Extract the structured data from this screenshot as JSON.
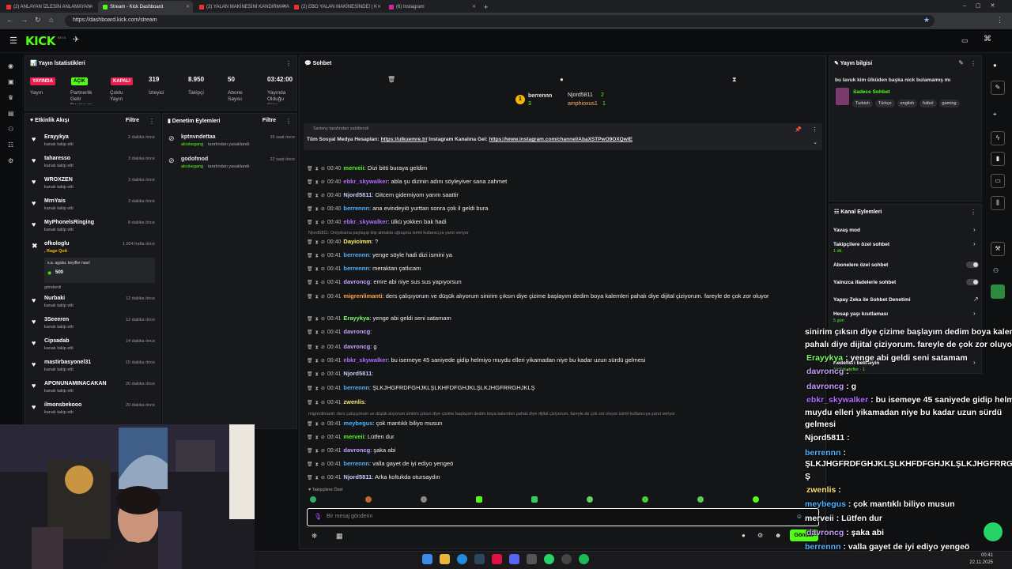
{
  "browser": {
    "tabs": [
      {
        "label": "(2) ANLAYAN İZLESİN ANLAMAYAN",
        "color": "#e33"
      },
      {
        "label": "Stream - Kick Dashboard",
        "color": "#53fc18"
      },
      {
        "label": "(2) YALAN MAKİNESİNİ KANDIRMAYA",
        "color": "#e33"
      },
      {
        "label": "(2) EBO YALAN MAKİNESİNDE! | K",
        "color": "#e33"
      },
      {
        "label": "(6) Instagram",
        "color": "#d6249f"
      }
    ],
    "url": "https://dashboard.kick.com/stream"
  },
  "header": {
    "logo": "KICK",
    "beta": "BETA"
  },
  "stats": {
    "title": "Yayın İstatistikleri",
    "badges": [
      "YAYINDA",
      "AÇIK",
      "KAPALI"
    ],
    "badge_colors": [
      "#e91e4d",
      "#53fc18",
      "#e91e4d"
    ],
    "badge_labels": [
      "Yayın",
      "Partnerlik Gelir Paylaşımı",
      "Çoklu Yayın"
    ],
    "values": [
      "319",
      "8.950",
      "50",
      "03:42:00"
    ],
    "labels": [
      "İzleyici",
      "Takipçi",
      "Abone Sayısı",
      "Yayında Olduğu Süre"
    ]
  },
  "events": {
    "title": "Etkinlik Akışı",
    "filter": "Filtre",
    "items": [
      {
        "name": "Erayykya",
        "sub": "kanalı takip etti",
        "time": "2 dakika önce"
      },
      {
        "name": "taharesso",
        "sub": "kanalı takip etti",
        "time": "3 dakika önce"
      },
      {
        "name": "WROXZEN",
        "sub": "kanalı takip etti",
        "time": "3 dakika önce"
      },
      {
        "name": "MrnYais",
        "sub": "kanalı takip etti",
        "time": "3 dakika önce"
      },
      {
        "name": "MyPhonelsRinging",
        "sub": "kanalı takip etti",
        "time": "8 dakika önce"
      },
      {
        "name": "ofkologlu",
        "sub": ", Rage Quit",
        "time": "1.924 hafta önce",
        "note": "s.a. agalar, keyifler nasıl",
        "amount": "500",
        "extra": "gönderdi"
      },
      {
        "name": "Nurbaki",
        "sub": "kanalı takip etti",
        "time": "12 dakika önce"
      },
      {
        "name": "3Seeeren",
        "sub": "kanalı takip etti",
        "time": "12 dakika önce"
      },
      {
        "name": "Cipsadab",
        "sub": "kanalı takip etti",
        "time": "14 dakika önce"
      },
      {
        "name": "mastirbasyonel31",
        "sub": "kanalı takip etti",
        "time": "15 dakika önce"
      },
      {
        "name": "APONUNAMINACAKAN",
        "sub": "kanalı takip etti",
        "time": "20 dakika önce"
      },
      {
        "name": "ilmonsbekooo",
        "sub": "kanalı takip etti",
        "time": "20 dakika önce"
      }
    ]
  },
  "moderation": {
    "title": "Denetim Eylemleri",
    "filter": "Filtre",
    "items": [
      {
        "name": "kptnvndettaa",
        "by": "aloskegang",
        "action": "tarafından yasaklandı",
        "time": "16 saat önce"
      },
      {
        "name": "godofmod",
        "by": "aloskegang",
        "action": "tarafından yasaklandı",
        "time": "22 saat önce"
      }
    ]
  },
  "chat": {
    "title": "Sohbet",
    "pinned_by": "Sarteny tarafından sabitlendi",
    "pinned_text": "Tüm Sosyal Medya Hesapları:",
    "pinned_link1": "https://ulkuemre.tr/",
    "pinned_mid": "Instagram Kanalına Gel:",
    "pinned_link2": "https://www.instagram.com/channel/AbaXSTPwO9OXQwIE",
    "top_gifters": [
      {
        "name": "berrennn",
        "count": "3"
      },
      {
        "name": "Njord5811",
        "count": "2"
      },
      {
        "name": "amphioxus1",
        "count": "1"
      }
    ],
    "messages": [
      {
        "time": "00:40",
        "user": "merveii",
        "color": "#53fc18",
        "text": "Dizi bitti buraya geldim"
      },
      {
        "time": "00:40",
        "user": "ebkr_skywalker",
        "color": "#b06cff",
        "text": "abla şu dizinin adını söyleyiver sana zahmet"
      },
      {
        "time": "00:40",
        "user": "Njord5811",
        "color": "#c8c8ff",
        "text": "Gitcem gidemiyom yarım saattir"
      },
      {
        "time": "00:40",
        "user": "berrennn",
        "color": "#4fb3ff",
        "text": "ana evindeyiö yurttan sonra çok il geldi bura"
      },
      {
        "time": "00:40",
        "user": "ebkr_skywalker",
        "color": "#b06cff",
        "text": "ülkü yokken bak hadi"
      },
      {
        "reply": "Njord5811: Onlydrama paylaşıp klip almakla uğraşma isimli kullanıcıya yanıt veriyor"
      },
      {
        "time": "00:40",
        "user": "Dayicimm",
        "color": "#fff36b",
        "text": "?"
      },
      {
        "time": "00:41",
        "user": "berrennn",
        "color": "#4fb3ff",
        "text": "yenge söyle hadi dizi ismini ya"
      },
      {
        "time": "00:41",
        "user": "berrennn",
        "color": "#4fb3ff",
        "text": "meraktan çatlıcam"
      },
      {
        "time": "00:41",
        "user": "davroncg",
        "color": "#c9a0ff",
        "text": "emre abi niye sus sus yapıyorsun"
      },
      {
        "time": "00:41",
        "user": "migrenlimanti",
        "color": "#ffa43a",
        "text": "ders çalışıyorum ve düşük alıyorum sinirim çıksın diye çizime başlayım dedim boya kalemleri pahalı diye dijital çiziyorum. fareyle de çok zor",
        "wrap": "oluyor"
      },
      {
        "time": "00:41",
        "user": "Erayykya",
        "color": "#7cff6a",
        "text": "yenge abi geldi seni satamam"
      },
      {
        "time": "00:41",
        "user": "davroncg",
        "color": "#c9a0ff",
        "text": ""
      },
      {
        "time": "00:41",
        "user": "davroncg",
        "color": "#c9a0ff",
        "text": "g"
      },
      {
        "time": "00:41",
        "user": "ebkr_skywalker",
        "color": "#b06cff",
        "text": "bu isemeye 45 saniyede gidip helmiyo muydu elleri yikamadan niye bu kadar uzun sürdü gelmesi"
      },
      {
        "time": "00:41",
        "user": "Njord5811",
        "color": "#c8c8ff",
        "text": ""
      },
      {
        "time": "00:41",
        "user": "berrennn",
        "color": "#4fb3ff",
        "text": "ŞLKJHGFRDFGHJKLŞLKHFDFGHJKLŞLKJHGFRRGHJKLŞ"
      },
      {
        "time": "00:41",
        "user": "zwenlis",
        "color": "#ffe56b",
        "text": ""
      },
      {
        "reply": "migrenlimanti: ders çalışıyorum ve düşük alıyorum sinirim çıksın diye çizime başlayım dedim boya kalemleri pahalı diye dijital çiziyorum. fareyle de çok zor oluyor isimli kullanıcıya yanıt veriyor"
      },
      {
        "time": "00:41",
        "user": "meybegus",
        "color": "#4fb3ff",
        "text": "çok mantıklı biliyo musun"
      },
      {
        "time": "00:41",
        "user": "merveii",
        "color": "#53fc18",
        "text": "Lütfen dur"
      },
      {
        "time": "00:41",
        "user": "davroncg",
        "color": "#c9a0ff",
        "text": "şaka abi"
      },
      {
        "time": "00:41",
        "user": "berrennn",
        "color": "#4fb3ff",
        "text": "valla gayet de iyi ediyo yengeö"
      },
      {
        "time": "00:41",
        "user": "Njord5811",
        "color": "#c8c8ff",
        "text": "Arka koltukda otursaydın"
      }
    ],
    "followers_only": "Takipçilere Özel",
    "input_placeholder": "Bir mesaj gönderin",
    "send": "Gönder"
  },
  "info": {
    "title": "Yayın bilgisi",
    "stream_title": "bu lavuk kim ülküden başka nick bulamamış mı",
    "category": "Sadece Sohbet",
    "tags": [
      "Turkish",
      "Türkçe",
      "english",
      "futbol",
      "gaming"
    ]
  },
  "channel_actions": {
    "title": "Kanal Eylemleri",
    "items": [
      {
        "label": "Yavaş mod",
        "sub": "",
        "kind": "chevron"
      },
      {
        "label": "Takipçilere özel sohbet",
        "sub": "1 dk.",
        "kind": "chevron"
      },
      {
        "label": "Abonelere özel sohbet",
        "sub": "",
        "kind": "toggle"
      },
      {
        "label": "Yalnızca ifadelerle sohbet",
        "sub": "",
        "kind": "toggle"
      },
      {
        "label": "Yapay Zeka ile Sohbet Denetimi",
        "sub": "",
        "kind": "link"
      },
      {
        "label": "Hesap yaşı kısıtlaması",
        "sub": "5 gün",
        "kind": "chevron"
      },
      {
        "label": "Hedefleri belirleyin",
        "sub": "Aktif hedefler · 1",
        "kind": "chevron"
      }
    ]
  },
  "overlay": {
    "lines": [
      {
        "user": "",
        "text": "sinirim çıksın diye çizime başlayım dedim boya kalemleri"
      },
      {
        "user": "",
        "text": "pahalı diye dijital çiziyorum. fareyle de çok zor oluyor"
      },
      {
        "user": "Erayykya",
        "text": ": yenge abi geldi seni satamam"
      },
      {
        "user": "davroncg",
        "text": ":"
      },
      {
        "user": "davroncg",
        "text": ": g"
      },
      {
        "user": "ebkr_skywalker",
        "text": ": bu isemeye 45 saniyede gidip helmiyo"
      },
      {
        "user": "",
        "text": "muydu elleri yikamadan niye bu kadar uzun sürdü"
      },
      {
        "user": "",
        "text": "gelmesi"
      },
      {
        "user": "Njord5811",
        "text": ":"
      },
      {
        "user": "berrennn",
        "text": ":"
      },
      {
        "user": "",
        "text": "ŞLKJHGFRDFGHJKLŞLKHFDFGHJKLŞLKJHGFRRGHJKL"
      },
      {
        "user": "",
        "text": "Ş"
      },
      {
        "user": "zwenlis",
        "text": ":"
      },
      {
        "user": "meybegus",
        "text": ": çok mantıklı biliyo musun"
      },
      {
        "user": "merveii",
        "text": ": Lütfen dur"
      },
      {
        "user": "davroncg",
        "text": ": şaka abi"
      },
      {
        "user": "berrennn",
        "text": ": valla gayet de iyi ediyo yengeö"
      },
      {
        "user": "Njord5811",
        "text": ": Arka koltukda otursaydın"
      }
    ]
  },
  "taskbar": {
    "time": "00:41",
    "date": "22.11.2025"
  }
}
